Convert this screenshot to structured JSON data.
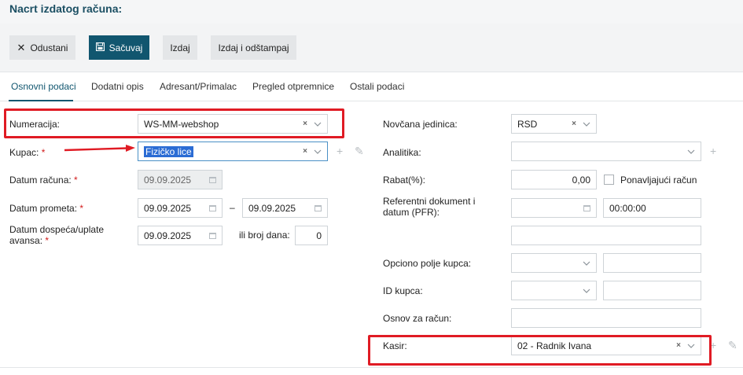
{
  "page": {
    "title": "Nacrt izdatog računa:"
  },
  "toolbar": {
    "cancel_label": "Odustani",
    "save_label": "Sačuvaj",
    "issue_label": "Izdaj",
    "issue_print_label": "Izdaj i odštampaj"
  },
  "tabs": [
    "Osnovni podaci",
    "Dodatni opis",
    "Adresant/Primalac",
    "Pregled otpremnice",
    "Ostali podaci"
  ],
  "left": {
    "numeracija": {
      "label": "Numeracija:",
      "value": "WS-MM-webshop"
    },
    "kupac": {
      "label": "Kupac:",
      "required": "*",
      "value": "Fizičko lice"
    },
    "datum_racuna": {
      "label": "Datum računa:",
      "required": "*",
      "value": "09.09.2025"
    },
    "datum_prometa": {
      "label": "Datum prometa:",
      "required": "*",
      "from": "09.09.2025",
      "dash": "–",
      "to": "09.09.2025"
    },
    "datum_dospeca": {
      "label_line1": "Datum dospeća/uplate",
      "label_line2": "avansa:",
      "required": "*",
      "value": "09.09.2025",
      "broj_dana_label": "ili broj dana:",
      "broj_dana": "0"
    }
  },
  "right": {
    "novcana": {
      "label": "Novčana jedinica:",
      "value": "RSD"
    },
    "analitika": {
      "label": "Analitika:",
      "value": ""
    },
    "rabat": {
      "label": "Rabat(%):",
      "value": "0,00",
      "recurring_label": "Ponavljajući račun"
    },
    "ref_dok": {
      "label_line1": "Referentni dokument i",
      "label_line2": "datum (PFR):",
      "date": "",
      "time": "00:00:00",
      "extra": ""
    },
    "opciono": {
      "label": "Opciono polje kupca:",
      "value": "",
      "text": ""
    },
    "id_kupca": {
      "label": "ID kupca:",
      "value": "",
      "text": ""
    },
    "osnov": {
      "label": "Osnov za račun:",
      "value": ""
    },
    "kasir": {
      "label": "Kasir:",
      "value": "02 - Radnik Ivana"
    }
  },
  "icons": {
    "clear": "×",
    "plus": "+",
    "pencil": "✎",
    "close": "✕"
  },
  "colors": {
    "accent": "#11566f",
    "highlight": "#e01b24",
    "selection": "#2b6cd4"
  }
}
